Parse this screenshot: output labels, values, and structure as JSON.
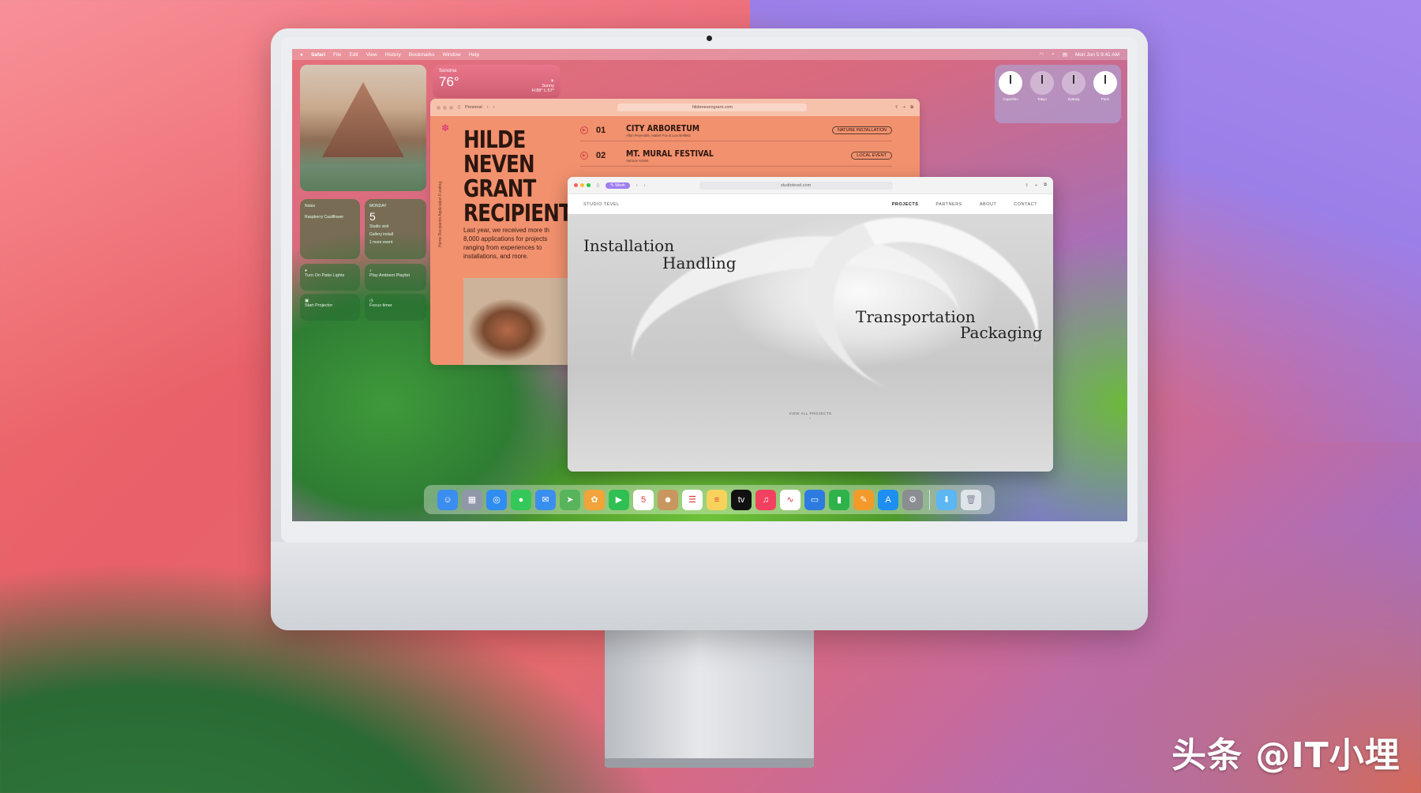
{
  "menubar": {
    "app": "Safari",
    "items": [
      "File",
      "Edit",
      "View",
      "History",
      "Bookmarks",
      "Window",
      "Help"
    ],
    "clock": "Mon Jun 5  9:41 AM"
  },
  "widgets": {
    "weather": {
      "city": "Sonoma",
      "temp": "76°",
      "condition": "Sunny",
      "range": "H:88° L:57°"
    },
    "notes": {
      "title": "Notes",
      "line1": "Raspberry Cauliflower"
    },
    "calendar": {
      "dow": "MONDAY",
      "day": "5",
      "ev1": "Studio visit",
      "ev2": "Gallery install",
      "more": "1 more event"
    },
    "shortcuts": [
      "Turn On Patio Lights",
      "Play Ambient Playlist",
      "Start Projector",
      "Focus timer"
    ],
    "clocks": [
      {
        "city": "Cupertino"
      },
      {
        "city": "Tokyo"
      },
      {
        "city": "Sydney"
      },
      {
        "city": "Paris"
      }
    ]
  },
  "window1": {
    "tab": "Personal",
    "url": "hildenevengrant.com",
    "side_nav": "Home  Recipients  Application  Funding",
    "headline": "HILDE NEVEN GRANT RECIPIENT",
    "intro": "Last year, we received more th 8,000 applications for projects ranging from experiences to installations, and more.",
    "events": [
      {
        "num": "01",
        "name": "CITY ARBORETUM",
        "sub": "Allyn Reynolds, Isabel Fox & Lou Bellettz",
        "tag": "NATURE INSTALLATION"
      },
      {
        "num": "02",
        "name": "MT. MURAL FESTIVAL",
        "sub": "Various Artists",
        "tag": "LOCAL EVENT"
      }
    ]
  },
  "window2": {
    "tab": "Work",
    "url": "studiotevel.com",
    "brand": "STUDIO TEVEL",
    "nav": [
      "PROJECTS",
      "PARTNERS",
      "ABOUT",
      "CONTACT"
    ],
    "hero": [
      "Installation",
      "Handling",
      "Transportation",
      "Packaging"
    ],
    "view_all": "VIEW ALL PROJECTS"
  },
  "dock": {
    "apps": [
      {
        "icon": "finder-icon",
        "color": "#3b8df0",
        "glyph": "☺"
      },
      {
        "icon": "launchpad-icon",
        "color": "#8f97a8",
        "glyph": "▦"
      },
      {
        "icon": "safari-icon",
        "color": "#2f8df2",
        "glyph": "◎"
      },
      {
        "icon": "messages-icon",
        "color": "#34c759",
        "glyph": "●"
      },
      {
        "icon": "mail-icon",
        "color": "#3a8fee",
        "glyph": "✉"
      },
      {
        "icon": "maps-icon",
        "color": "#57b45a",
        "glyph": "➤"
      },
      {
        "icon": "photos-icon",
        "color": "#f2a33a",
        "glyph": "✿"
      },
      {
        "icon": "facetime-icon",
        "color": "#2fbf52",
        "glyph": "▶"
      },
      {
        "icon": "calendar-icon",
        "color": "#ffffff",
        "glyph": "5"
      },
      {
        "icon": "contacts-icon",
        "color": "#c8965f",
        "glyph": "☻"
      },
      {
        "icon": "reminders-icon",
        "color": "#ffffff",
        "glyph": "☰"
      },
      {
        "icon": "notes-icon",
        "color": "#f7d35c",
        "glyph": "≡"
      },
      {
        "icon": "tv-icon",
        "color": "#111111",
        "glyph": "tv"
      },
      {
        "icon": "music-icon",
        "color": "#f44060",
        "glyph": "♫"
      },
      {
        "icon": "freeform-icon",
        "color": "#ffffff",
        "glyph": "∿"
      },
      {
        "icon": "keynote-icon",
        "color": "#2d7be0",
        "glyph": "▭"
      },
      {
        "icon": "numbers-icon",
        "color": "#2fb24a",
        "glyph": "▮"
      },
      {
        "icon": "pages-icon",
        "color": "#f39a2a",
        "glyph": "✎"
      },
      {
        "icon": "app-store-icon",
        "color": "#1d8ff0",
        "glyph": "A"
      },
      {
        "icon": "settings-icon",
        "color": "#8a8d92",
        "glyph": "⚙"
      },
      {
        "icon": "downloads-folder-icon",
        "color": "#5bb6f2",
        "glyph": "⬇"
      },
      {
        "icon": "trash-icon",
        "color": "#dfe4ea",
        "glyph": "🗑"
      }
    ]
  },
  "watermark": "头条 @IT小埋"
}
